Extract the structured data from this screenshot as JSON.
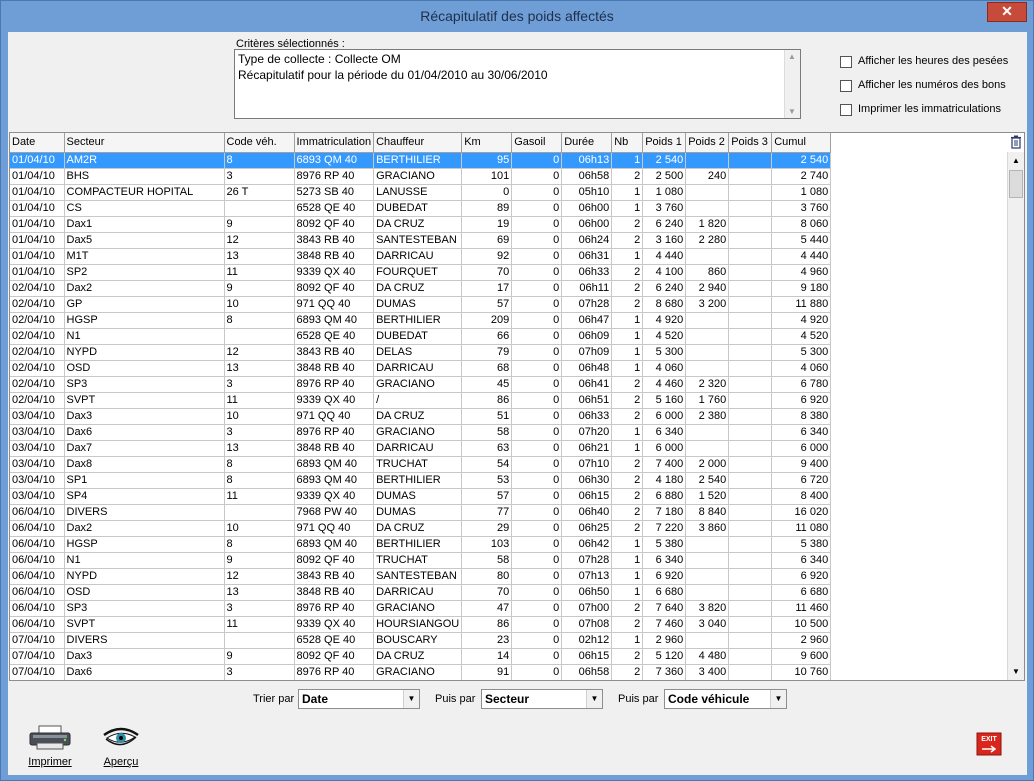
{
  "window": {
    "title": "Récapitulatif des poids affectés",
    "close_label": "✕"
  },
  "criteria": {
    "label": "Critères sélectionnés :",
    "lines": [
      "Type de collecte : Collecte OM",
      "Récapitulatif pour la période du 01/04/2010 au 30/06/2010"
    ]
  },
  "options": [
    "Afficher les heures des pesées",
    "Afficher les numéros des bons",
    "Imprimer les immatriculations"
  ],
  "table": {
    "columns": [
      "Date",
      "Secteur",
      "Code véh.",
      "Immatriculation",
      "Chauffeur",
      "Km",
      "Gasoil",
      "Durée",
      "Nb",
      "Poids 1",
      "Poids 2",
      "Poids 3",
      "Cumul"
    ],
    "rows": [
      [
        "01/04/10",
        "AM2R",
        "8",
        "6893 QM 40",
        "BERTHILIER",
        "95",
        "0",
        "06h13",
        "1",
        "2 540",
        "",
        "",
        "2 540"
      ],
      [
        "01/04/10",
        "BHS",
        "3",
        "8976 RP 40",
        "GRACIANO",
        "101",
        "0",
        "06h58",
        "2",
        "2 500",
        "240",
        "",
        "2 740"
      ],
      [
        "01/04/10",
        "COMPACTEUR HOPITAL",
        "26 T",
        "5273 SB 40",
        "LANUSSE",
        "0",
        "0",
        "05h10",
        "1",
        "1 080",
        "",
        "",
        "1 080"
      ],
      [
        "01/04/10",
        "CS",
        "",
        "6528 QE 40",
        "DUBEDAT",
        "89",
        "0",
        "06h00",
        "1",
        "3 760",
        "",
        "",
        "3 760"
      ],
      [
        "01/04/10",
        "Dax1",
        "9",
        "8092 QF 40",
        "DA CRUZ",
        "19",
        "0",
        "06h00",
        "2",
        "6 240",
        "1 820",
        "",
        "8 060"
      ],
      [
        "01/04/10",
        "Dax5",
        "12",
        "3843 RB 40",
        "SANTESTEBAN",
        "69",
        "0",
        "06h24",
        "2",
        "3 160",
        "2 280",
        "",
        "5 440"
      ],
      [
        "01/04/10",
        "M1T",
        "13",
        "3848 RB 40",
        "DARRICAU",
        "92",
        "0",
        "06h31",
        "1",
        "4 440",
        "",
        "",
        "4 440"
      ],
      [
        "01/04/10",
        "SP2",
        "11",
        "9339 QX 40",
        "FOURQUET",
        "70",
        "0",
        "06h33",
        "2",
        "4 100",
        "860",
        "",
        "4 960"
      ],
      [
        "02/04/10",
        "Dax2",
        "9",
        "8092 QF 40",
        "DA CRUZ",
        "17",
        "0",
        "06h11",
        "2",
        "6 240",
        "2 940",
        "",
        "9 180"
      ],
      [
        "02/04/10",
        "GP",
        "10",
        "971 QQ 40",
        "DUMAS",
        "57",
        "0",
        "07h28",
        "2",
        "8 680",
        "3 200",
        "",
        "11 880"
      ],
      [
        "02/04/10",
        "HGSP",
        "8",
        "6893 QM 40",
        "BERTHILIER",
        "209",
        "0",
        "06h47",
        "1",
        "4 920",
        "",
        "",
        "4 920"
      ],
      [
        "02/04/10",
        "N1",
        "",
        "6528 QE 40",
        "DUBEDAT",
        "66",
        "0",
        "06h09",
        "1",
        "4 520",
        "",
        "",
        "4 520"
      ],
      [
        "02/04/10",
        "NYPD",
        "12",
        "3843 RB 40",
        "DELAS",
        "79",
        "0",
        "07h09",
        "1",
        "5 300",
        "",
        "",
        "5 300"
      ],
      [
        "02/04/10",
        "OSD",
        "13",
        "3848 RB 40",
        "DARRICAU",
        "68",
        "0",
        "06h48",
        "1",
        "4 060",
        "",
        "",
        "4 060"
      ],
      [
        "02/04/10",
        "SP3",
        "3",
        "8976 RP 40",
        "GRACIANO",
        "45",
        "0",
        "06h41",
        "2",
        "4 460",
        "2 320",
        "",
        "6 780"
      ],
      [
        "02/04/10",
        "SVPT",
        "11",
        "9339 QX 40",
        "/",
        "86",
        "0",
        "06h51",
        "2",
        "5 160",
        "1 760",
        "",
        "6 920"
      ],
      [
        "03/04/10",
        "Dax3",
        "10",
        "971 QQ 40",
        "DA CRUZ",
        "51",
        "0",
        "06h33",
        "2",
        "6 000",
        "2 380",
        "",
        "8 380"
      ],
      [
        "03/04/10",
        "Dax6",
        "3",
        "8976 RP 40",
        "GRACIANO",
        "58",
        "0",
        "07h20",
        "1",
        "6 340",
        "",
        "",
        "6 340"
      ],
      [
        "03/04/10",
        "Dax7",
        "13",
        "3848 RB 40",
        "DARRICAU",
        "63",
        "0",
        "06h21",
        "1",
        "6 000",
        "",
        "",
        "6 000"
      ],
      [
        "03/04/10",
        "Dax8",
        "8",
        "6893 QM 40",
        "TRUCHAT",
        "54",
        "0",
        "07h10",
        "2",
        "7 400",
        "2 000",
        "",
        "9 400"
      ],
      [
        "03/04/10",
        "SP1",
        "8",
        "6893 QM 40",
        "BERTHILIER",
        "53",
        "0",
        "06h30",
        "2",
        "4 180",
        "2 540",
        "",
        "6 720"
      ],
      [
        "03/04/10",
        "SP4",
        "11",
        "9339 QX 40",
        "DUMAS",
        "57",
        "0",
        "06h15",
        "2",
        "6 880",
        "1 520",
        "",
        "8 400"
      ],
      [
        "06/04/10",
        "DIVERS",
        "",
        "7968 PW 40",
        "DUMAS",
        "77",
        "0",
        "06h40",
        "2",
        "7 180",
        "8 840",
        "",
        "16 020"
      ],
      [
        "06/04/10",
        "Dax2",
        "10",
        "971 QQ 40",
        "DA CRUZ",
        "29",
        "0",
        "06h25",
        "2",
        "7 220",
        "3 860",
        "",
        "11 080"
      ],
      [
        "06/04/10",
        "HGSP",
        "8",
        "6893 QM 40",
        "BERTHILIER",
        "103",
        "0",
        "06h42",
        "1",
        "5 380",
        "",
        "",
        "5 380"
      ],
      [
        "06/04/10",
        "N1",
        "9",
        "8092 QF 40",
        "TRUCHAT",
        "58",
        "0",
        "07h28",
        "1",
        "6 340",
        "",
        "",
        "6 340"
      ],
      [
        "06/04/10",
        "NYPD",
        "12",
        "3843 RB 40",
        "SANTESTEBAN",
        "80",
        "0",
        "07h13",
        "1",
        "6 920",
        "",
        "",
        "6 920"
      ],
      [
        "06/04/10",
        "OSD",
        "13",
        "3848 RB 40",
        "DARRICAU",
        "70",
        "0",
        "06h50",
        "1",
        "6 680",
        "",
        "",
        "6 680"
      ],
      [
        "06/04/10",
        "SP3",
        "3",
        "8976 RP 40",
        "GRACIANO",
        "47",
        "0",
        "07h00",
        "2",
        "7 640",
        "3 820",
        "",
        "11 460"
      ],
      [
        "06/04/10",
        "SVPT",
        "11",
        "9339 QX 40",
        "HOURSIANGOU",
        "86",
        "0",
        "07h08",
        "2",
        "7 460",
        "3 040",
        "",
        "10 500"
      ],
      [
        "07/04/10",
        "DIVERS",
        "",
        "6528 QE 40",
        "BOUSCARY",
        "23",
        "0",
        "02h12",
        "1",
        "2 960",
        "",
        "",
        "2 960"
      ],
      [
        "07/04/10",
        "Dax3",
        "9",
        "8092 QF 40",
        "DA CRUZ",
        "14",
        "0",
        "06h15",
        "2",
        "5 120",
        "4 480",
        "",
        "9 600"
      ],
      [
        "07/04/10",
        "Dax6",
        "3",
        "8976 RP 40",
        "GRACIANO",
        "91",
        "0",
        "06h58",
        "2",
        "7 360",
        "3 400",
        "",
        "10 760"
      ]
    ]
  },
  "sort": {
    "label1": "Trier par",
    "value1": "Date",
    "label2": "Puis par",
    "value2": "Secteur",
    "label3": "Puis par",
    "value3": "Code véhicule"
  },
  "buttons": {
    "print": "Imprimer",
    "preview": "Aperçu",
    "exit": "EXIT"
  },
  "icons": {
    "printer": "printer-icon",
    "eye": "eye-icon",
    "exit": "exit-icon",
    "delete": "trash-icon"
  },
  "colors": {
    "titlebar": "#6f9ed6",
    "selection": "#3399ff",
    "exit": "#d9261c"
  }
}
